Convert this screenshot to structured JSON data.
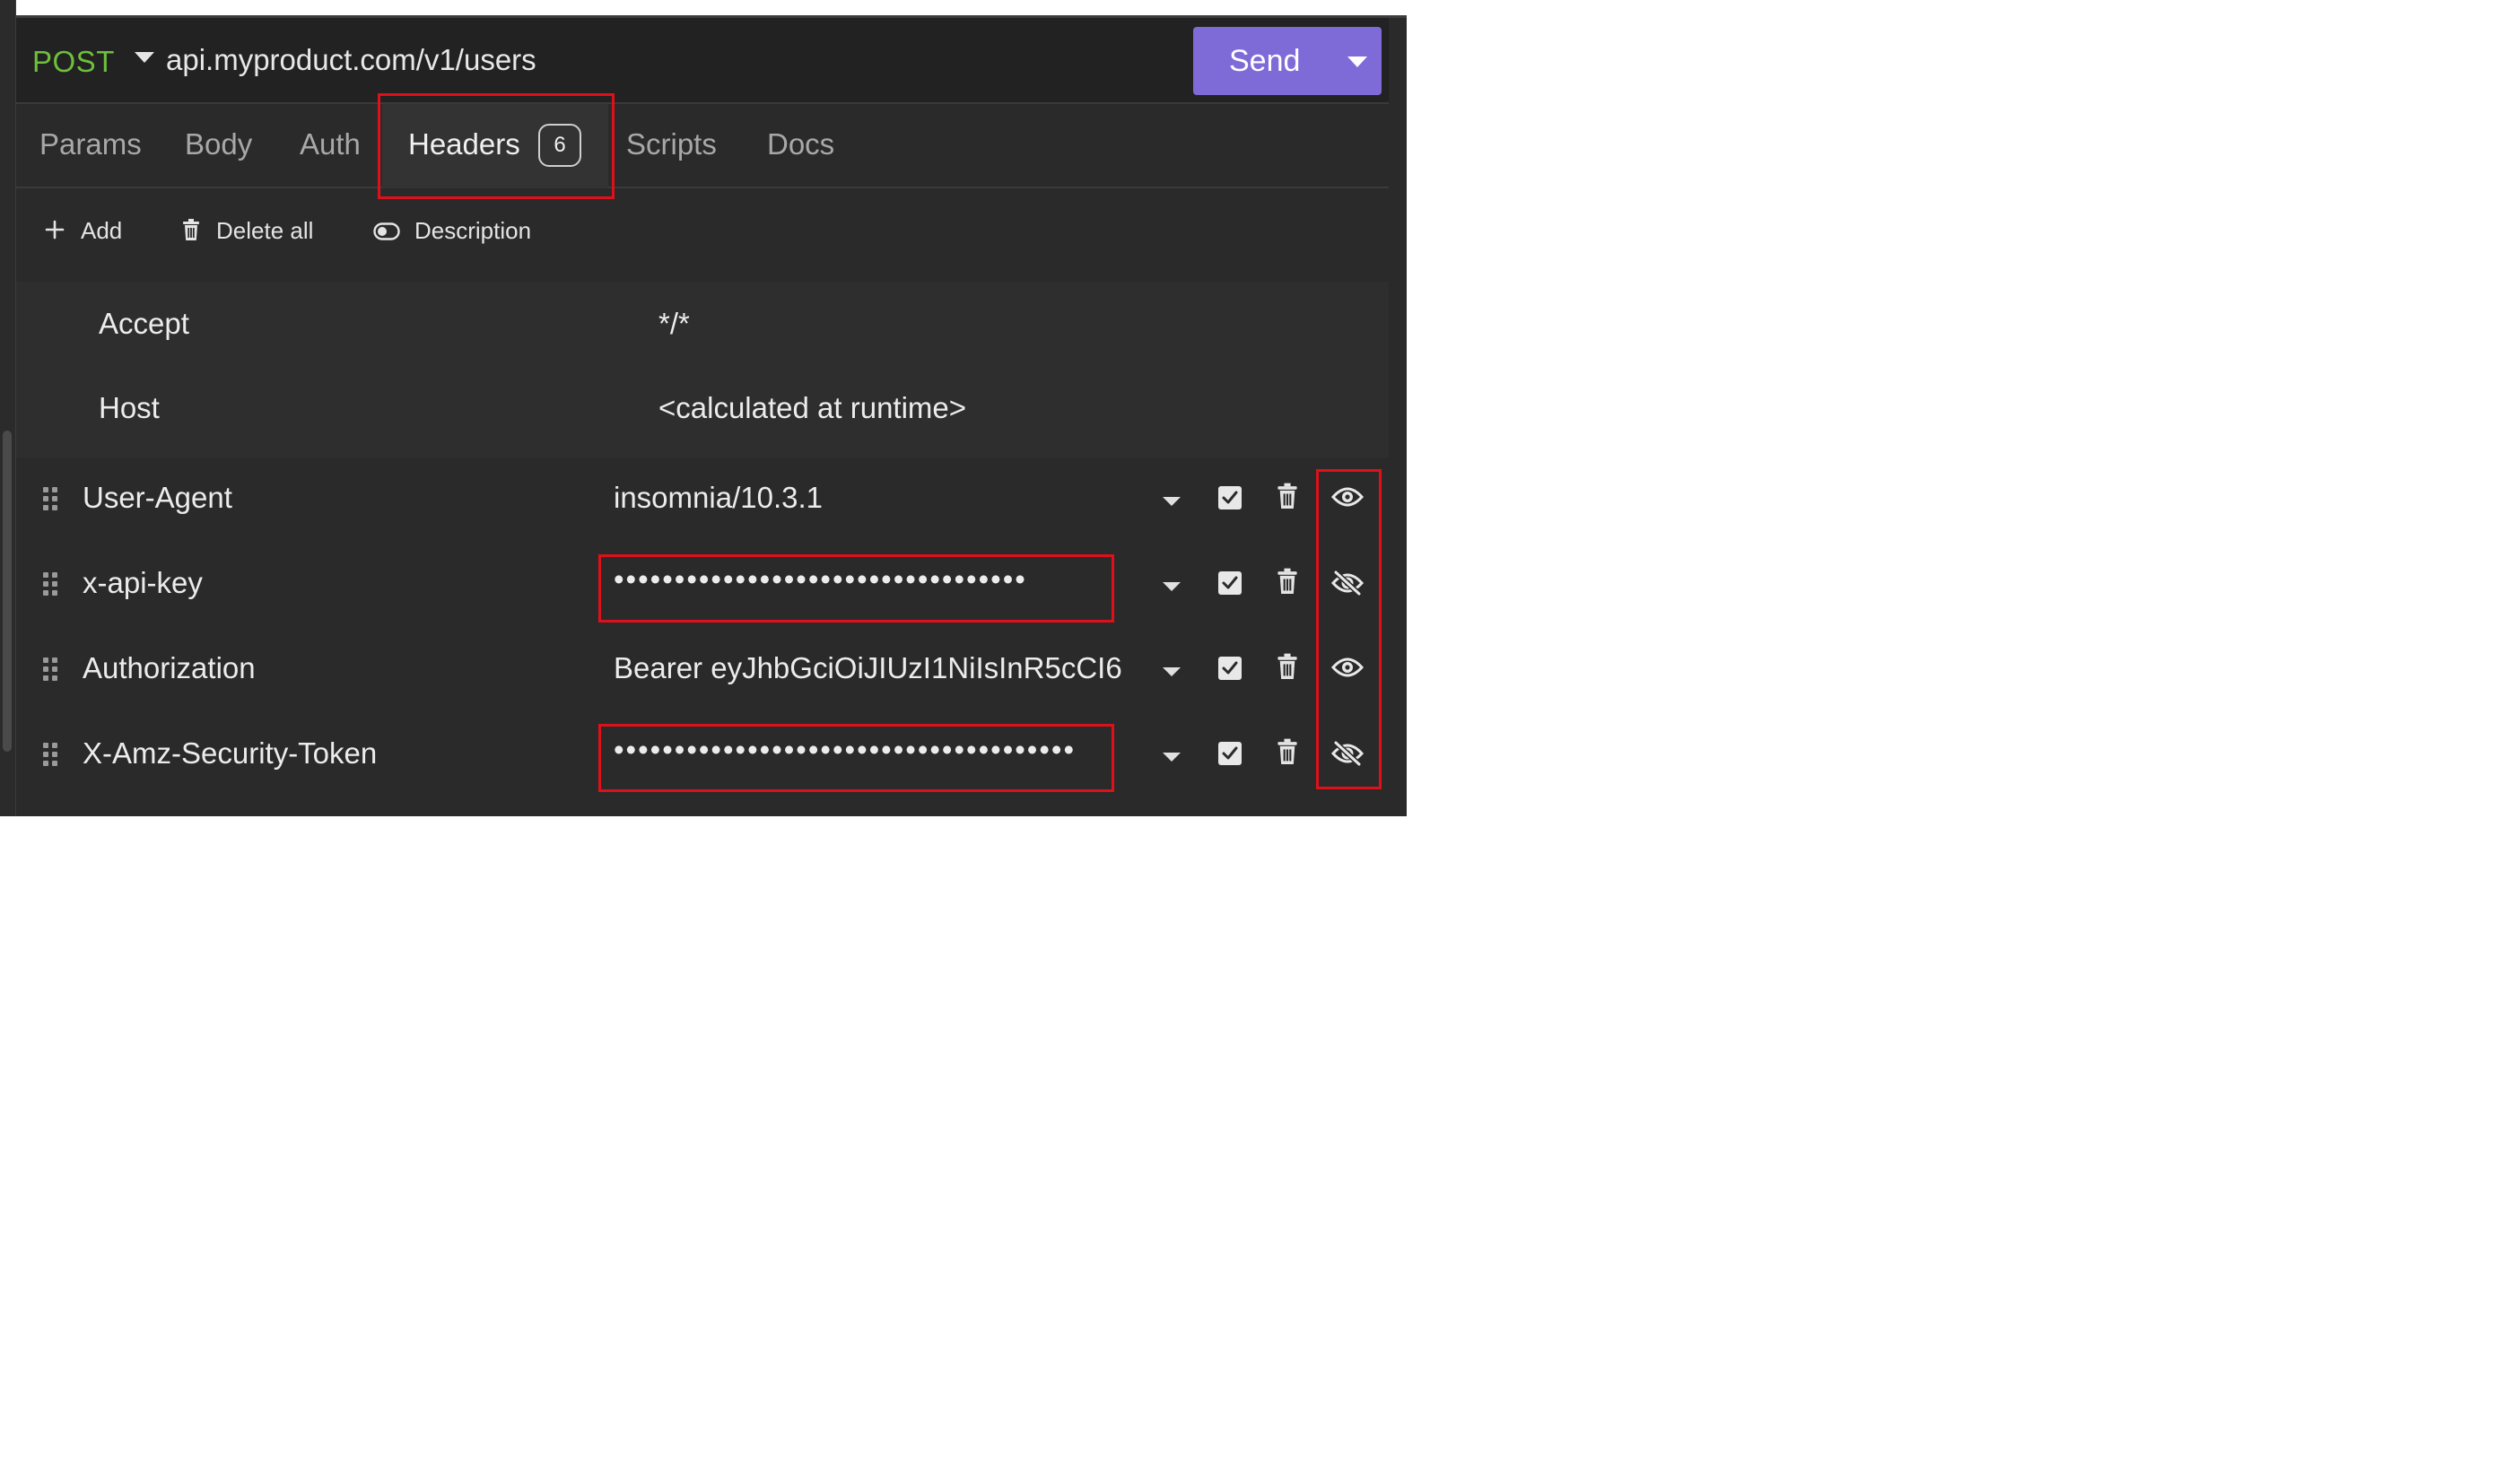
{
  "request": {
    "method": "POST",
    "url": "api.myproduct.com/v1/users",
    "send_label": "Send"
  },
  "tabs": [
    {
      "label": "Params"
    },
    {
      "label": "Body"
    },
    {
      "label": "Auth"
    },
    {
      "label": "Headers",
      "badge": "6",
      "active": true
    },
    {
      "label": "Scripts"
    },
    {
      "label": "Docs"
    }
  ],
  "toolbar": {
    "add_label": "Add",
    "delete_all_label": "Delete all",
    "description_label": "Description"
  },
  "readonly_headers": [
    {
      "name": "Accept",
      "value": "*/*"
    },
    {
      "name": "Host",
      "value": "<calculated at runtime>"
    }
  ],
  "headers": [
    {
      "name": "User-Agent",
      "value": "insomnia/10.3.1",
      "masked": false,
      "enabled": true,
      "visibility_icon": "eye-icon"
    },
    {
      "name": "x-api-key",
      "value": "••••••••••••••••••••••••••••••••••",
      "masked": true,
      "enabled": true,
      "visibility_icon": "eye-off-icon"
    },
    {
      "name": "Authorization",
      "value": "Bearer eyJhbGciOiJIUzI1NiIsInR5cCI6",
      "masked": false,
      "enabled": true,
      "visibility_icon": "eye-icon"
    },
    {
      "name": "X-Amz-Security-Token",
      "value": "••••••••••••••••••••••••••••••••••••••",
      "masked": true,
      "enabled": true,
      "visibility_icon": "eye-off-icon"
    }
  ],
  "colors": {
    "method": "#6ec03a",
    "send_button": "#7f6bd8",
    "highlight": "#e0101a",
    "background": "#2a2a2a"
  }
}
